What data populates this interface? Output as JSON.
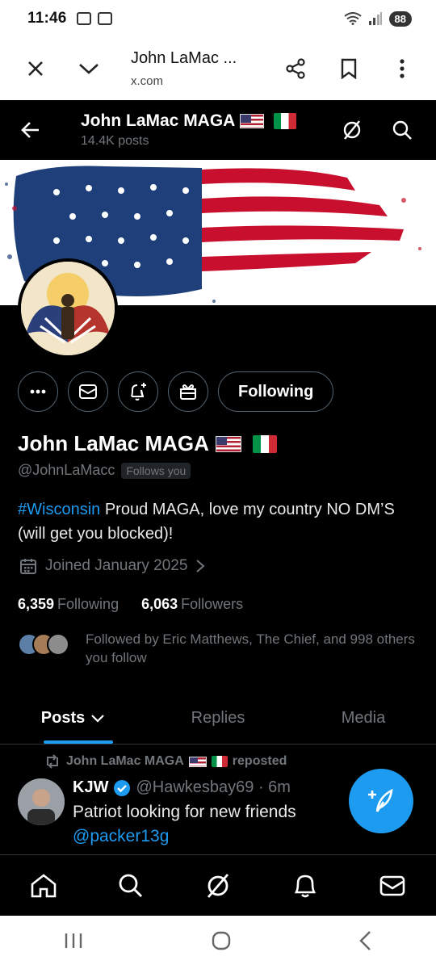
{
  "status_bar": {
    "time": "11:46",
    "battery": "88"
  },
  "browser": {
    "title": "John LaMac ...",
    "url": "x.com"
  },
  "profile_header": {
    "name": "John LaMac MAGA",
    "posts": "14.4K posts"
  },
  "profile": {
    "display_name": "John LaMac MAGA",
    "handle": "@JohnLaMacc",
    "follows_you": "Follows you",
    "following_button": "Following",
    "bio_hashtag": "#Wisconsin",
    "bio_text": " Proud MAGA, love my country NO DM’S (will get you blocked)!",
    "joined": "Joined January 2025",
    "following_count": "6,359",
    "following_label": "Following",
    "followers_count": "6,063",
    "followers_label": "Followers",
    "followed_by": "Followed by Eric Matthews, The Chief, and 998 others you follow"
  },
  "tabs": [
    {
      "label": "Posts"
    },
    {
      "label": "Replies"
    },
    {
      "label": "Media"
    }
  ],
  "post": {
    "reposter": "John LaMac MAGA",
    "reposted": "reposted",
    "author": "KJW",
    "handle_time": "@Hawkesbay69 · 6m",
    "text": "Patriot looking for new friends",
    "mention": "@packer13g"
  },
  "colors": {
    "accent": "#1d9bf0",
    "background": "#000000",
    "muted": "#71767b"
  }
}
